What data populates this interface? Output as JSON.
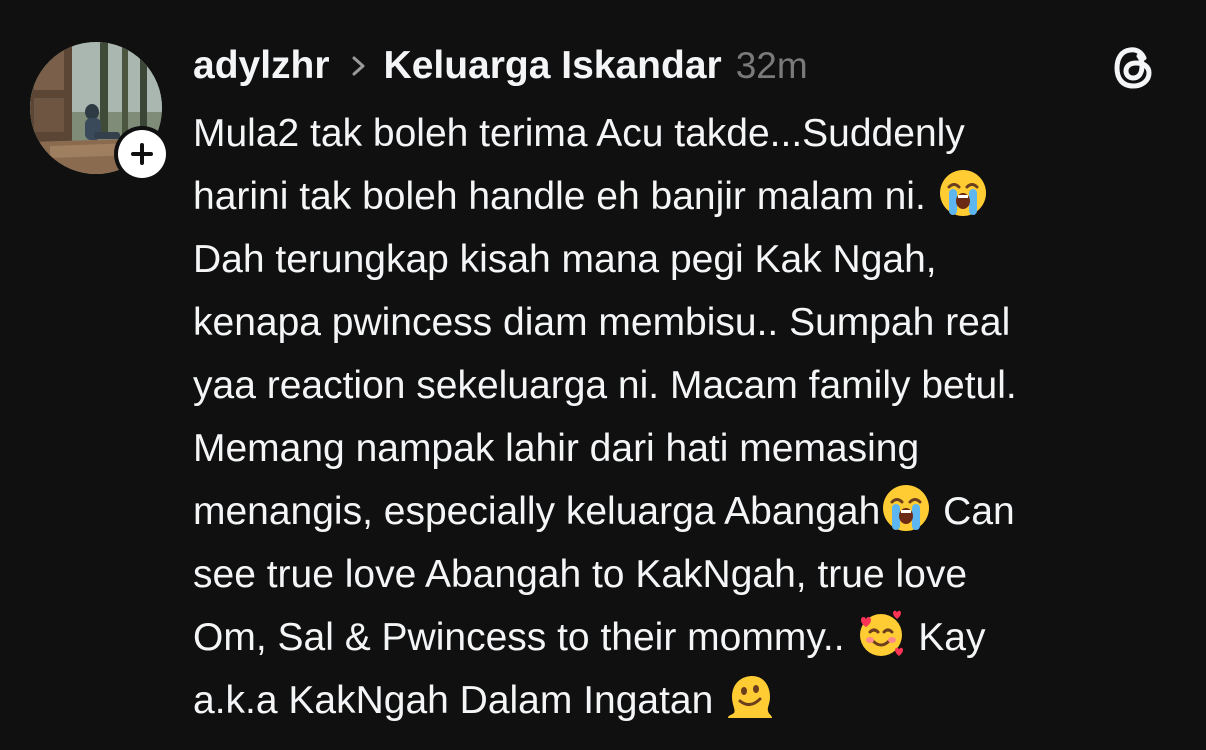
{
  "post": {
    "username": "adylzhr",
    "separator_icon": "chevron-right-icon",
    "community": "Keluarga Iskandar",
    "time": "32m",
    "app_icon": "threads-logo-icon",
    "follow_icon": "plus-icon",
    "body": {
      "line1": "Mula2 tak boleh terima Acu takde...Suddenly",
      "line2": "harini tak boleh handle eh banjir malam ni.",
      "line3": "Dah terungkap kisah mana pegi Kak Ngah,",
      "line4": "kenapa pwincess diam membisu.. Sumpah real",
      "line5": "yaa reaction sekeluarga ni. Macam family betul.",
      "line6": "Memang nampak lahir dari hati memasing",
      "line7a": "menangis, especially keluarga Abangah",
      "line7b": "Can",
      "line8": "see true love Abangah to KakNgah, true love",
      "line9a": "Om, Sal & Pwincess to their mommy..",
      "line9b": "Kay",
      "line10": "a.k.a KakNgah Dalam Ingatan"
    },
    "emojis": [
      "loudly-crying-face-emoji",
      "loudly-crying-face-emoji",
      "smiling-face-with-hearts-emoji",
      "melting-face-emoji"
    ]
  },
  "colors": {
    "background": "#101010",
    "text": "#f3f5f7",
    "muted": "#7a7a7a"
  }
}
